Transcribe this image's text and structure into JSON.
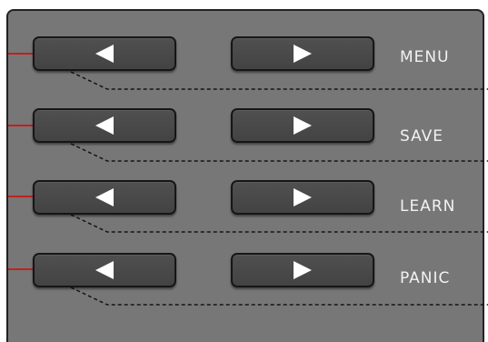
{
  "colors": {
    "panel": "#777777",
    "button": "#494949",
    "outline": "#161616",
    "indicator": "#c0211d",
    "label": "#f2f2f2"
  },
  "rows": [
    {
      "label": "MENU",
      "prev_icon": "triangle-left-icon",
      "next_icon": "triangle-right-icon"
    },
    {
      "label": "SAVE",
      "prev_icon": "triangle-left-icon",
      "next_icon": "triangle-right-icon"
    },
    {
      "label": "LEARN",
      "prev_icon": "triangle-left-icon",
      "next_icon": "triangle-right-icon"
    },
    {
      "label": "PANIC",
      "prev_icon": "triangle-left-icon",
      "next_icon": "triangle-right-icon"
    }
  ]
}
